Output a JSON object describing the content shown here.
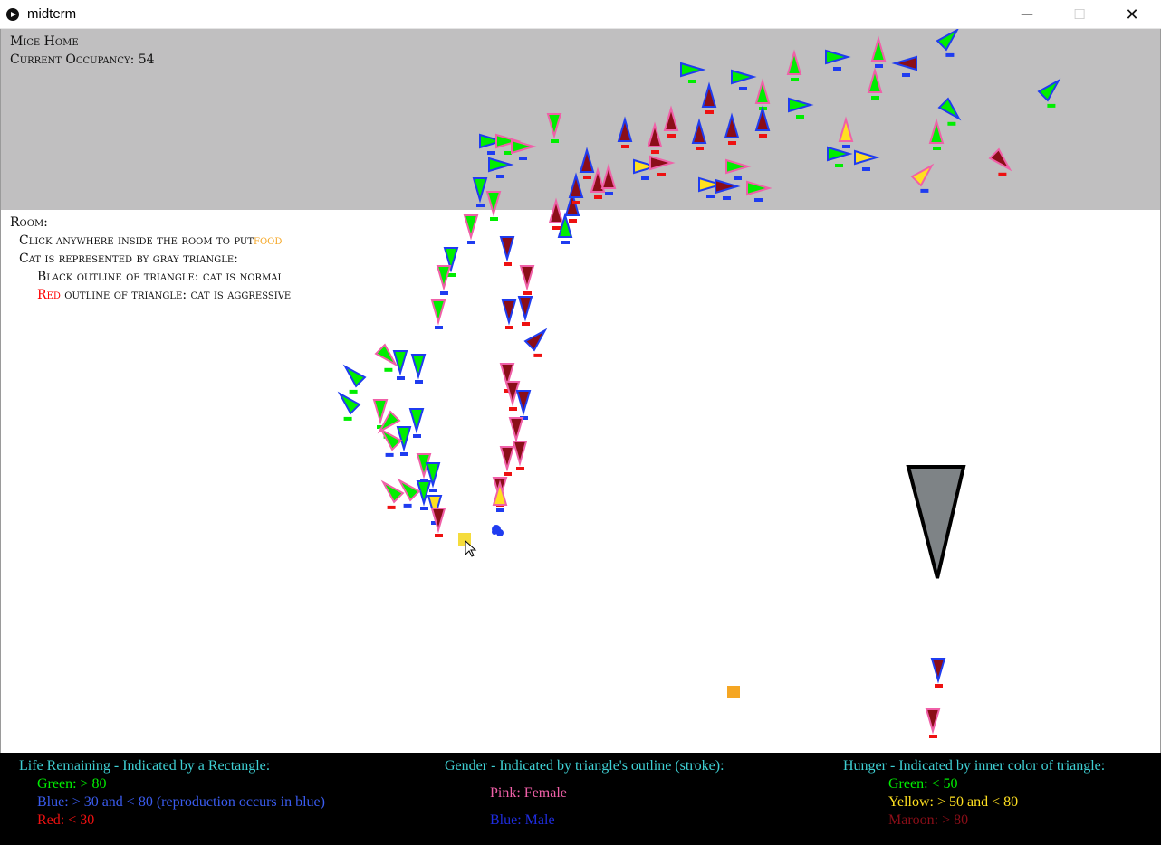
{
  "window": {
    "title": "midterm",
    "minimize_glyph": "—",
    "maximize_glyph": "☐",
    "close_glyph": "✕"
  },
  "mice_home": {
    "title": "Mice Home",
    "occupancy_line": "Current Occupancy: 54",
    "background": "#c0bfc0"
  },
  "room": {
    "heading": "Room:",
    "instruction_prefix": "Click anywhere inside the room to put",
    "instruction_food_word": "food",
    "cat_line": "Cat is represented by gray triangle:",
    "normal_line": "Black outline of triangle: cat is normal",
    "aggressive_red_word": "Red",
    "aggressive_rest": " outline of triangle: cat is aggressive"
  },
  "legend": {
    "life": {
      "title": "Life Remaining - Indicated by a Rectangle:",
      "green": "Green: > 80",
      "blue": "Blue: > 30 and < 80 (reproduction occurs in blue)",
      "red": "Red: < 30"
    },
    "gender": {
      "title": "Gender - Indicated by triangle's outline (stroke):",
      "pink": "Pink: Female",
      "blue": "Blue: Male"
    },
    "hunger": {
      "title": "Hunger - Indicated by inner color of triangle:",
      "green": "Green: < 50",
      "yellow": "Yellow: > 50 and < 80",
      "maroon": "Maroon: > 80"
    }
  },
  "colors": {
    "title_cyan": "#3fd0d4",
    "green": "#00ee00",
    "blue": "#1f3cf0",
    "red": "#ee1111",
    "pink": "#f060a8",
    "yellow": "#ffe020",
    "maroon": "#8b0e18",
    "food_yellow": "#f5dc3c",
    "food_orange": "#f5a623",
    "cat_fill": "#7e8386"
  }
}
